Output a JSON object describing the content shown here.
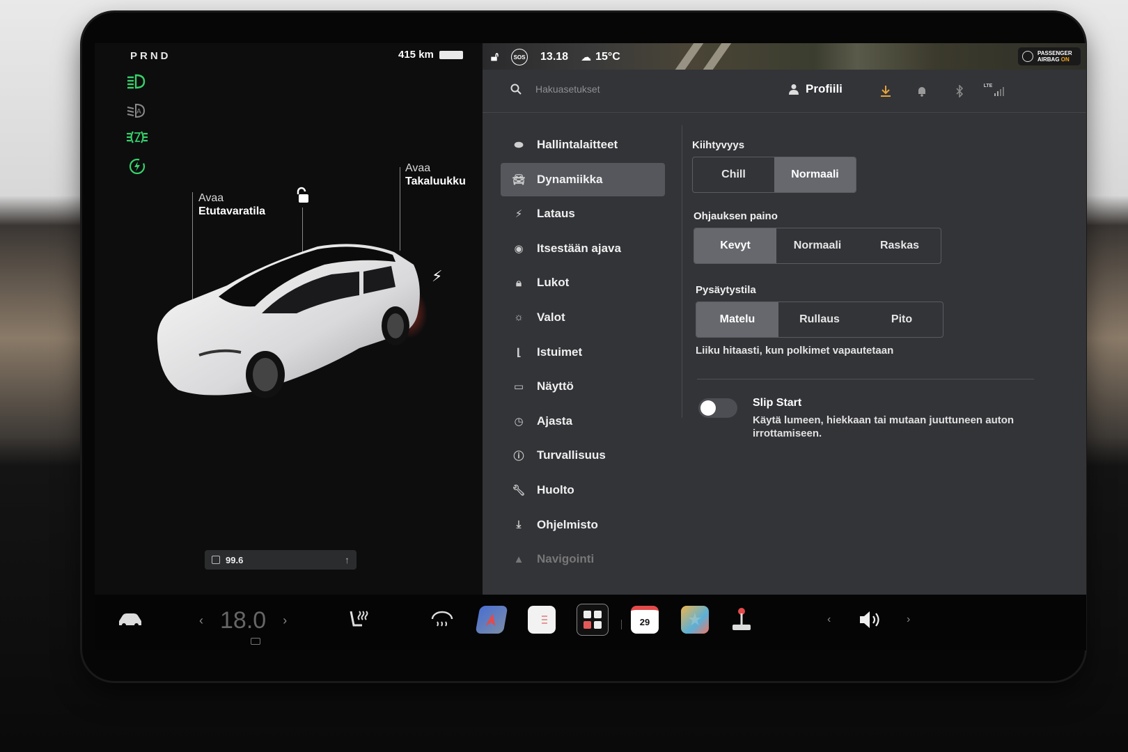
{
  "left_panel": {
    "gear_selector": "PRND",
    "range": "415 km",
    "frunk_callout": {
      "line1": "Avaa",
      "line2": "Etutavaratila"
    },
    "trunk_callout": {
      "line1": "Avaa",
      "line2": "Takaluukku"
    },
    "odometer": "99.6"
  },
  "status_bar": {
    "time": "13.18",
    "temperature": "15°C",
    "sos_label": "SOS",
    "airbag": {
      "line1": "PASSENGER",
      "line2": "AIRBAG",
      "state": "ON"
    }
  },
  "top_bar": {
    "search_placeholder": "Hakuasetukset",
    "profile_label": "Profiili",
    "lte_label": "LTE"
  },
  "menu": [
    {
      "label": "Hallintalaitteet",
      "icon": "toggle-icon"
    },
    {
      "label": "Dynamiikka",
      "icon": "car-icon"
    },
    {
      "label": "Lataus",
      "icon": "bolt-icon"
    },
    {
      "label": "Itsestään ajava",
      "icon": "steering-wheel-icon"
    },
    {
      "label": "Lukot",
      "icon": "lock-icon"
    },
    {
      "label": "Valot",
      "icon": "sun-icon"
    },
    {
      "label": "Istuimet",
      "icon": "seat-icon"
    },
    {
      "label": "Näyttö",
      "icon": "display-icon"
    },
    {
      "label": "Ajasta",
      "icon": "clock-icon"
    },
    {
      "label": "Turvallisuus",
      "icon": "alert-icon"
    },
    {
      "label": "Huolto",
      "icon": "wrench-icon"
    },
    {
      "label": "Ohjelmisto",
      "icon": "download-icon"
    },
    {
      "label": "Navigointi",
      "icon": "navigation-icon"
    }
  ],
  "settings": {
    "acceleration": {
      "title": "Kiihtyvyys",
      "options": [
        "Chill",
        "Normaali"
      ],
      "selected": "Normaali"
    },
    "steering": {
      "title": "Ohjauksen paino",
      "options": [
        "Kevyt",
        "Normaali",
        "Raskas"
      ],
      "selected": "Kevyt"
    },
    "stopping": {
      "title": "Pysäytystila",
      "options": [
        "Matelu",
        "Rullaus",
        "Pito"
      ],
      "selected": "Matelu",
      "description": "Liiku hitaasti, kun polkimet vapautetaan"
    },
    "slip_start": {
      "title": "Slip Start",
      "description": "Käytä lumeen, hiekkaan tai mutaan juuttuneen auton irrottamiseen.",
      "enabled": false
    }
  },
  "dock": {
    "temperature": "18.0",
    "calendar_day": "29"
  },
  "colors": {
    "indicator_green": "#36d26a",
    "charge_red": "#c0392b",
    "download_orange": "#e8a33b",
    "airbag_on": "#f5a623"
  }
}
